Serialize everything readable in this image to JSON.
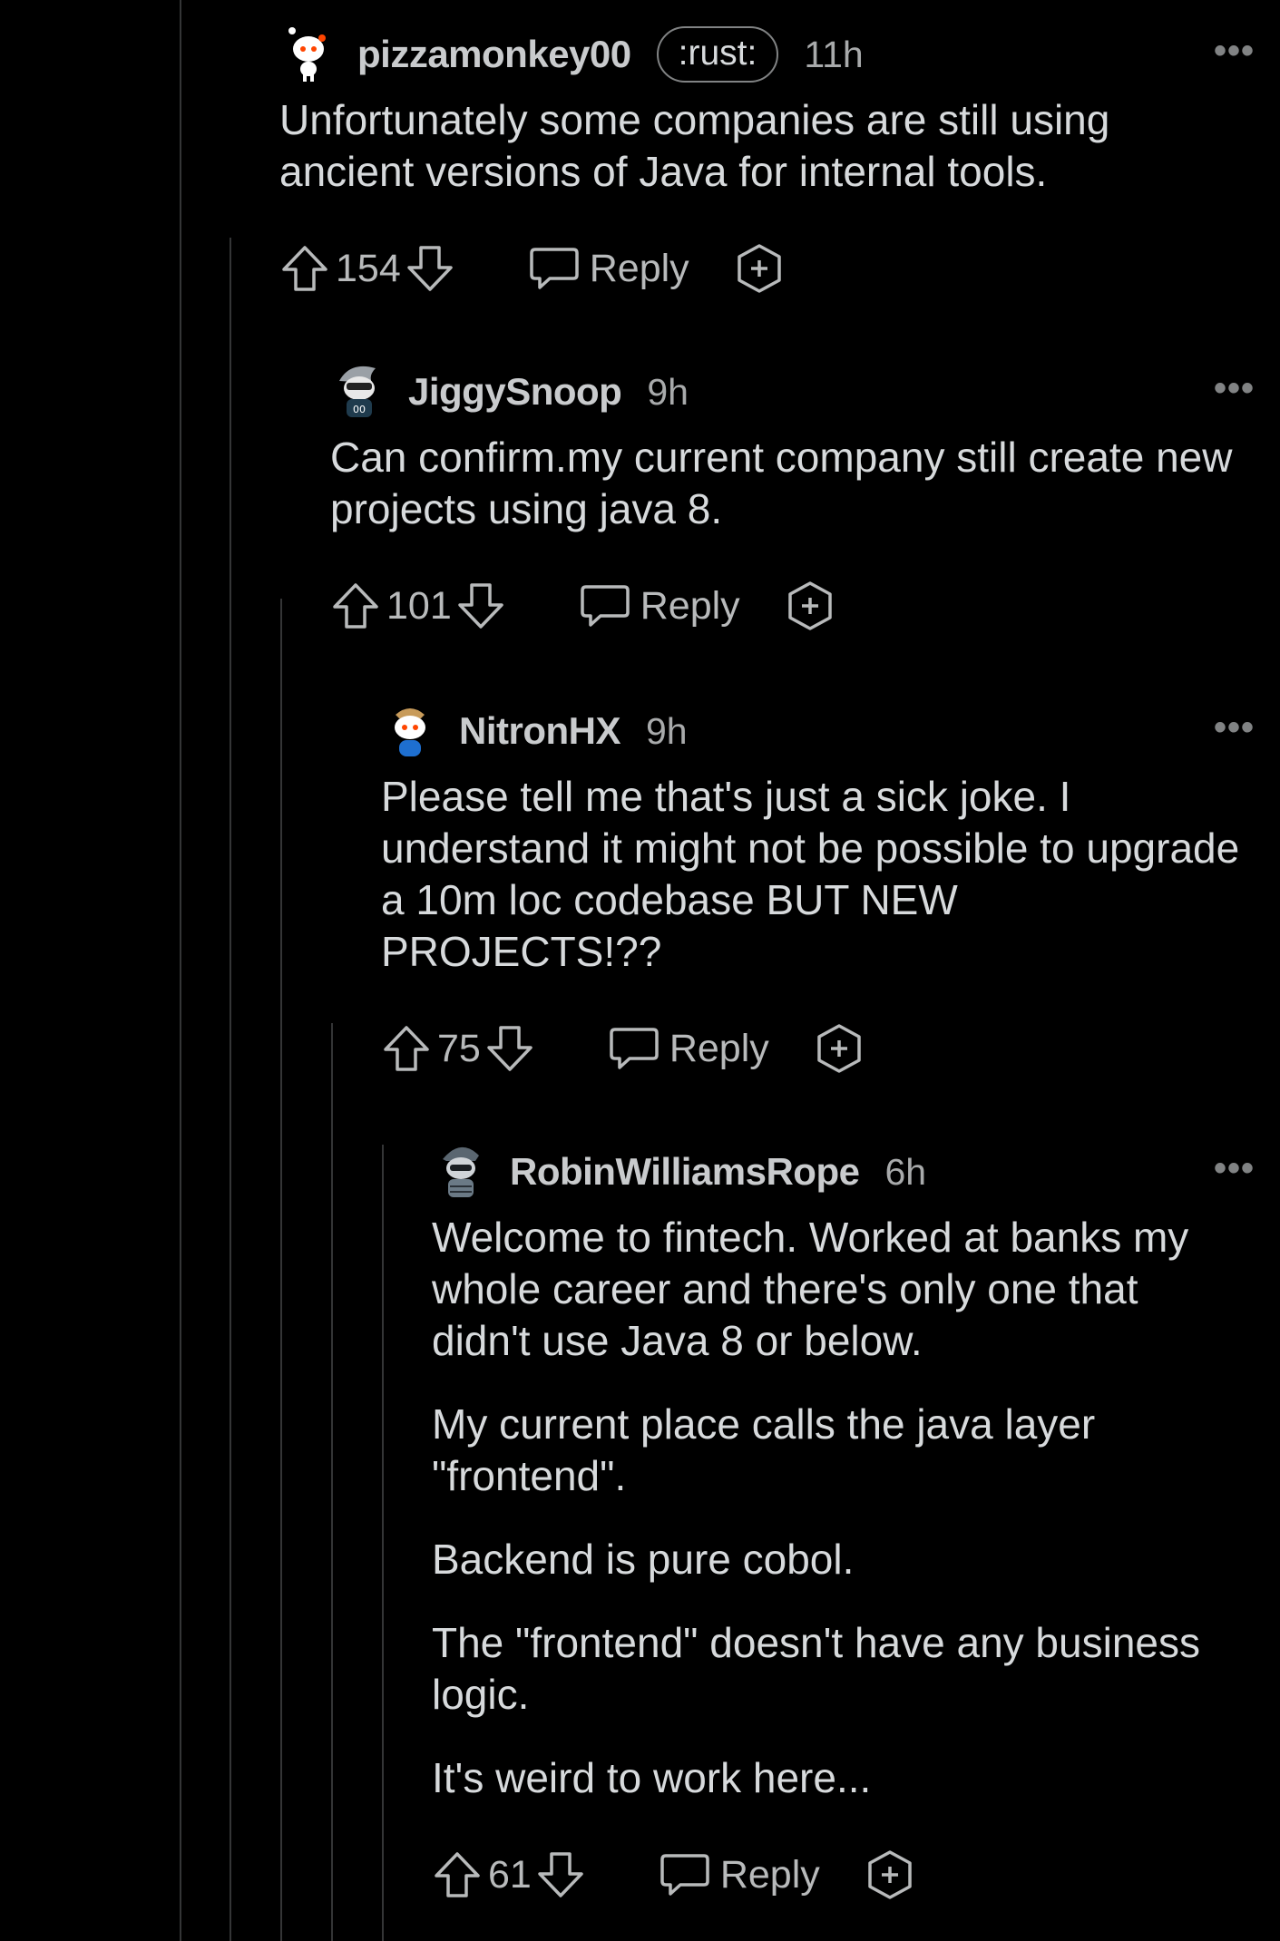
{
  "comments": [
    {
      "username": "pizzamonkey00",
      "flair": ":rust:",
      "time": "11h",
      "paragraphs": [
        "Unfortunately some companies are still using ancient versions of Java for internal tools."
      ],
      "score": "154",
      "reply_label": "Reply"
    },
    {
      "username": "JiggySnoop",
      "time": "9h",
      "paragraphs": [
        "Can confirm.my current company still create new projects using java 8."
      ],
      "score": "101",
      "reply_label": "Reply"
    },
    {
      "username": "NitronHX",
      "time": "9h",
      "paragraphs": [
        "Please tell me that's just a sick joke. I understand it might not be possible to upgrade a 10m loc codebase BUT NEW PROJECTS!??"
      ],
      "score": "75",
      "reply_label": "Reply"
    },
    {
      "username": "RobinWilliamsRope",
      "time": "6h",
      "paragraphs": [
        "Welcome to fintech. Worked at banks my whole career and there's only one that didn't use Java 8 or below.",
        "My current place calls the java layer \"frontend\".",
        "Backend is pure cobol.",
        "The \"frontend\" doesn't have any business logic.",
        "It's weird to work here..."
      ],
      "score": "61",
      "reply_label": "Reply"
    }
  ],
  "more_label": "•••",
  "colors": {
    "background": "#000000",
    "text": "#d7dadc",
    "muted": "#818384",
    "thread_line": "#343536"
  }
}
